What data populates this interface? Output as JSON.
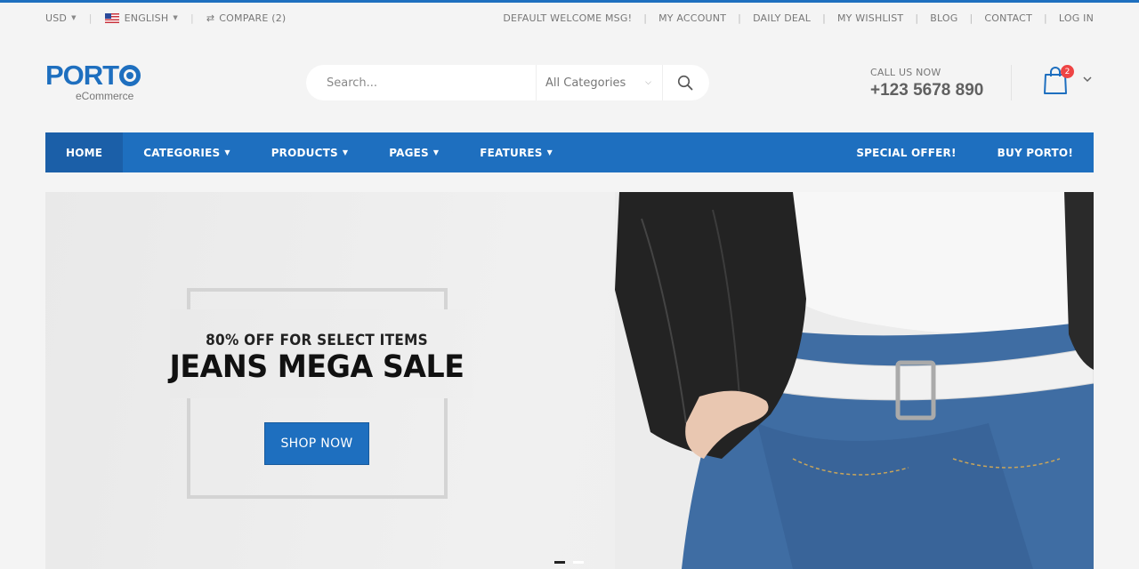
{
  "topbar": {
    "currency": "USD",
    "language": "ENGLISH",
    "compare": "COMPARE (2)",
    "links": [
      "DEFAULT WELCOME MSG!",
      "MY ACCOUNT",
      "DAILY DEAL",
      "MY WISHLIST",
      "BLOG",
      "CONTACT",
      "LOG IN"
    ]
  },
  "logo": {
    "main": "PORT",
    "sub": "eCommerce"
  },
  "search": {
    "placeholder": "Search...",
    "category": "All Categories"
  },
  "contact": {
    "label": "CALL US NOW",
    "phone": "+123 5678 890"
  },
  "cart": {
    "count": "2"
  },
  "nav": {
    "items": [
      {
        "label": "HOME"
      },
      {
        "label": "CATEGORIES"
      },
      {
        "label": "PRODUCTS"
      },
      {
        "label": "PAGES"
      },
      {
        "label": "FEATURES"
      }
    ],
    "right": [
      {
        "label": "SPECIAL OFFER!"
      },
      {
        "label": "BUY PORTO!"
      }
    ]
  },
  "hero": {
    "subtitle": "80% OFF FOR SELECT ITEMS",
    "title": "JEANS MEGA SALE",
    "button": "SHOP NOW"
  },
  "colors": {
    "accent": "#1e6fbf",
    "badge": "#ee4444"
  },
  "icons": [
    "flag-us-icon",
    "compare-icon",
    "search-icon",
    "chevron-down-icon",
    "cart-bag-icon"
  ]
}
